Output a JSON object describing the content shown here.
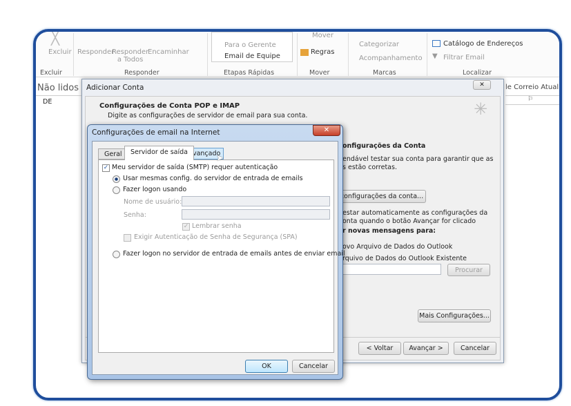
{
  "ribbon": {
    "delete": {
      "label": "Excluir",
      "group": "Excluir"
    },
    "respond": {
      "reply": "Responder",
      "reply_all_1": "Responder",
      "reply_all_2": "a Todos",
      "forward": "Encaminhar",
      "group": "Responder"
    },
    "quick_steps": {
      "item1": "Para o Gerente",
      "item2": "Email de Equipe",
      "group": "Etapas Rápidas"
    },
    "move": {
      "move": "Mover",
      "rules": "Regras",
      "group": "Mover"
    },
    "tags": {
      "categorize": "Categorizar",
      "followup": "Acompanhamento",
      "group": "Marcas"
    },
    "find": {
      "address_book": "Catálogo de Endereços",
      "filter": "Filtrar Email",
      "group": "Localizar"
    }
  },
  "mail": {
    "unread": "Não lidos",
    "col_from": "DE",
    "search_scope": "le Correio Atual"
  },
  "add_account": {
    "title": "Adicionar Conta",
    "heading": "Configurações de Conta POP e IMAP",
    "subheading": "Digite as configurações de servidor de email para sua conta.",
    "test_heading": "onfigurações da Conta",
    "test_text_1": "endável testar sua conta para garantir que as",
    "test_text_2": "s estão corretas.",
    "test_button": "configurações da conta...",
    "auto_test_1": "estar automaticamente as configurações da",
    "auto_test_2": "onta quando o botão Avançar for clicado",
    "deliver_heading": "r novas mensagens para:",
    "new_file": "ovo Arquivo de Dados do Outlook",
    "existing_file": "rquivo de Dados do Outlook Existente",
    "browse": "Procurar",
    "more_settings": "Mais Configurações...",
    "back": "< Voltar",
    "next": "Avançar >",
    "cancel": "Cancelar"
  },
  "internet_settings": {
    "title": "Configurações de email na Internet",
    "tabs": [
      "Geral",
      "Servidor de saída",
      "Avançado"
    ],
    "active_tab": "Servidor de saída",
    "smtp_auth": "Meu servidor de saída (SMTP) requer autenticação",
    "smtp_auth_checked": true,
    "same_settings": "Usar mesmas config. do servidor de entrada de emails",
    "logon_using": "Fazer logon usando",
    "username_label": "Nome de usuário:",
    "username_value": "",
    "password_label": "Senha:",
    "password_value": "",
    "remember": "Lembrar senha",
    "spa": "Exigir Autenticação de Senha de Segurança (SPA)",
    "logon_incoming": "Fazer logon no servidor de entrada de emails antes de enviar email",
    "ok": "OK",
    "cancel": "Cancelar"
  }
}
